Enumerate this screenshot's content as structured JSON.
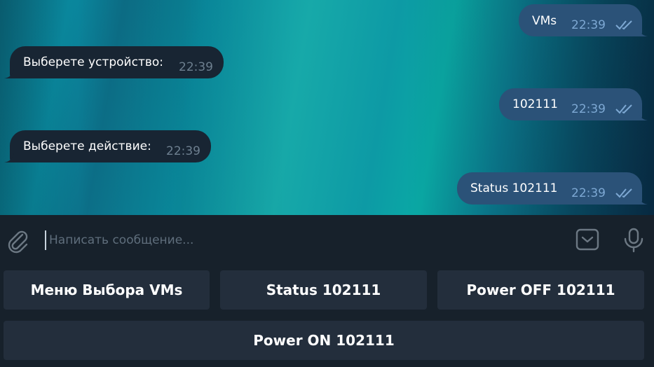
{
  "messages": [
    {
      "dir": "out",
      "text": "VMs",
      "time": "22:39"
    },
    {
      "dir": "in",
      "text": "Выберете устройство:",
      "time": "22:39"
    },
    {
      "dir": "out",
      "text": "102111",
      "time": "22:39"
    },
    {
      "dir": "in",
      "text": "Выберете действие:",
      "time": "22:39"
    },
    {
      "dir": "out",
      "text": "Status 102111",
      "time": "22:39"
    }
  ],
  "composer": {
    "placeholder": "Написать сообщение...",
    "icons": {
      "attach": "paperclip-icon",
      "keyboard": "keyboard-toggle-icon",
      "mic": "microphone-icon"
    }
  },
  "keyboard": {
    "buttons": [
      "Меню Выбора VMs",
      "Status 102111",
      "Power OFF 102111",
      "Power ON 102111"
    ]
  },
  "colors": {
    "incoming_bubble": "#182533",
    "outgoing_bubble": "#2b5278",
    "panel": "#17212b",
    "keyboard_button": "#232e3c",
    "read_check": "#7da8d3"
  }
}
